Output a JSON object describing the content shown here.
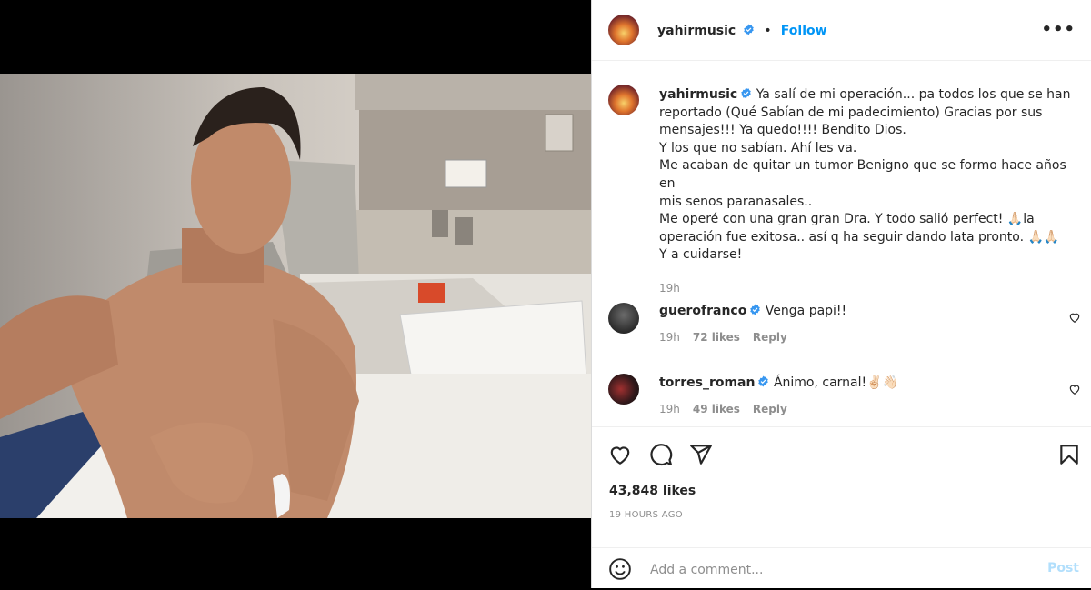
{
  "post": {
    "username": "yahirmusic",
    "follow_label": "Follow",
    "more_label": "•••",
    "caption_lines": [
      "Ya salí de mi operación... pa todos los que se han",
      "reportado (Qué Sabían de mi padecimiento) Gracias por sus",
      "mensajes!!! Ya quedo!!!! Bendito Dios.",
      "Y los que no sabían. Ahí les va.",
      "Me acaban de quitar un tumor Benigno que se formo hace años en",
      "mis senos paranasales..",
      "Me operé con una gran gran Dra. Y todo salió perfect! 🙏🏻la",
      "operación fue exitosa.. así q ha seguir dando lata pronto. 🙏🏻🙏🏻",
      "Y a cuidarse!"
    ],
    "caption_time": "19h",
    "likes": "43,848 likes",
    "posted": "19 HOURS AGO"
  },
  "comments": [
    {
      "user": "guerofranco",
      "text": "Venga papi!!",
      "time": "19h",
      "likes": "72 likes",
      "reply": "Reply"
    },
    {
      "user": "torres_roman",
      "text": "Ánimo, carnal!✌🏻👋🏻",
      "time": "19h",
      "likes": "49 likes",
      "reply": "Reply"
    }
  ],
  "add_comment": {
    "placeholder": "Add a comment...",
    "post_label": "Post"
  },
  "colors": {
    "accent": "#0095f6",
    "verified": "#3897f0",
    "muted": "#8e8e8e"
  },
  "icons": [
    "like-icon",
    "comment-icon",
    "share-icon",
    "save-icon",
    "emoji-icon",
    "verified-icon",
    "more-icon"
  ]
}
